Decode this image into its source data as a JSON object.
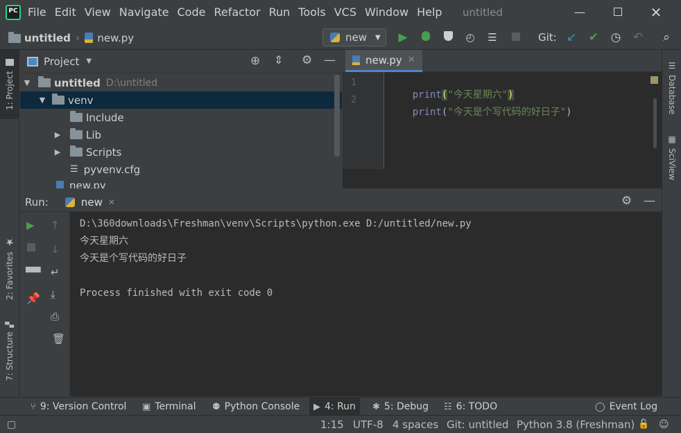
{
  "menubar": {
    "logo_text": "PC",
    "items": [
      "File",
      "Edit",
      "View",
      "Navigate",
      "Code",
      "Refactor",
      "Run",
      "Tools",
      "VCS",
      "Window",
      "Help"
    ],
    "window_title": "untitled"
  },
  "breadcrumb": {
    "project": "untitled",
    "file": "new.py"
  },
  "toolbar": {
    "run_config": "new",
    "git_label": "Git:"
  },
  "left_strip": {
    "project_tab": "1: Project",
    "favorites_tab": "2: Favorites",
    "structure_tab": "7: Structure"
  },
  "right_strip": {
    "database_tab": "Database",
    "sciview_tab": "SciView"
  },
  "project_panel": {
    "title": "Project",
    "tree": [
      {
        "label": "untitled",
        "path": "D:\\untitled"
      },
      {
        "label": "venv"
      },
      {
        "label": "Include"
      },
      {
        "label": "Lib"
      },
      {
        "label": "Scripts"
      },
      {
        "label": "pyvenv.cfg"
      },
      {
        "label": "new.py"
      }
    ]
  },
  "editor": {
    "tab_label": "new.py",
    "lines": [
      {
        "num": "1",
        "kw": "print",
        "open": "(",
        "str": "\"今天星期六\"",
        "close": ")"
      },
      {
        "num": "2",
        "kw": "print",
        "open": "(",
        "str": "\"今天是个写代码的好日子\"",
        "close": ")"
      }
    ]
  },
  "run_panel": {
    "label": "Run:",
    "tab_label": "new",
    "output": [
      "D:\\360downloads\\Freshman\\venv\\Scripts\\python.exe D:/untitled/new.py",
      "今天星期六",
      "今天是个写代码的好日子",
      "",
      "Process finished with exit code 0"
    ]
  },
  "bottom_tabs": {
    "version_control": "9: Version Control",
    "terminal": "Terminal",
    "python_console": "Python Console",
    "run": "4: Run",
    "debug": "5: Debug",
    "todo": "6: TODO",
    "event_log": "Event Log"
  },
  "status_bar": {
    "position": "1:15",
    "encoding": "UTF-8",
    "indent": "4 spaces",
    "git": "Git: untitled",
    "interpreter": "Python 3.8 (Freshman)"
  },
  "colors": {
    "accent": "#4a88c7",
    "run_green": "#499c54",
    "keyword": "#8888c6",
    "string": "#6a8759"
  }
}
